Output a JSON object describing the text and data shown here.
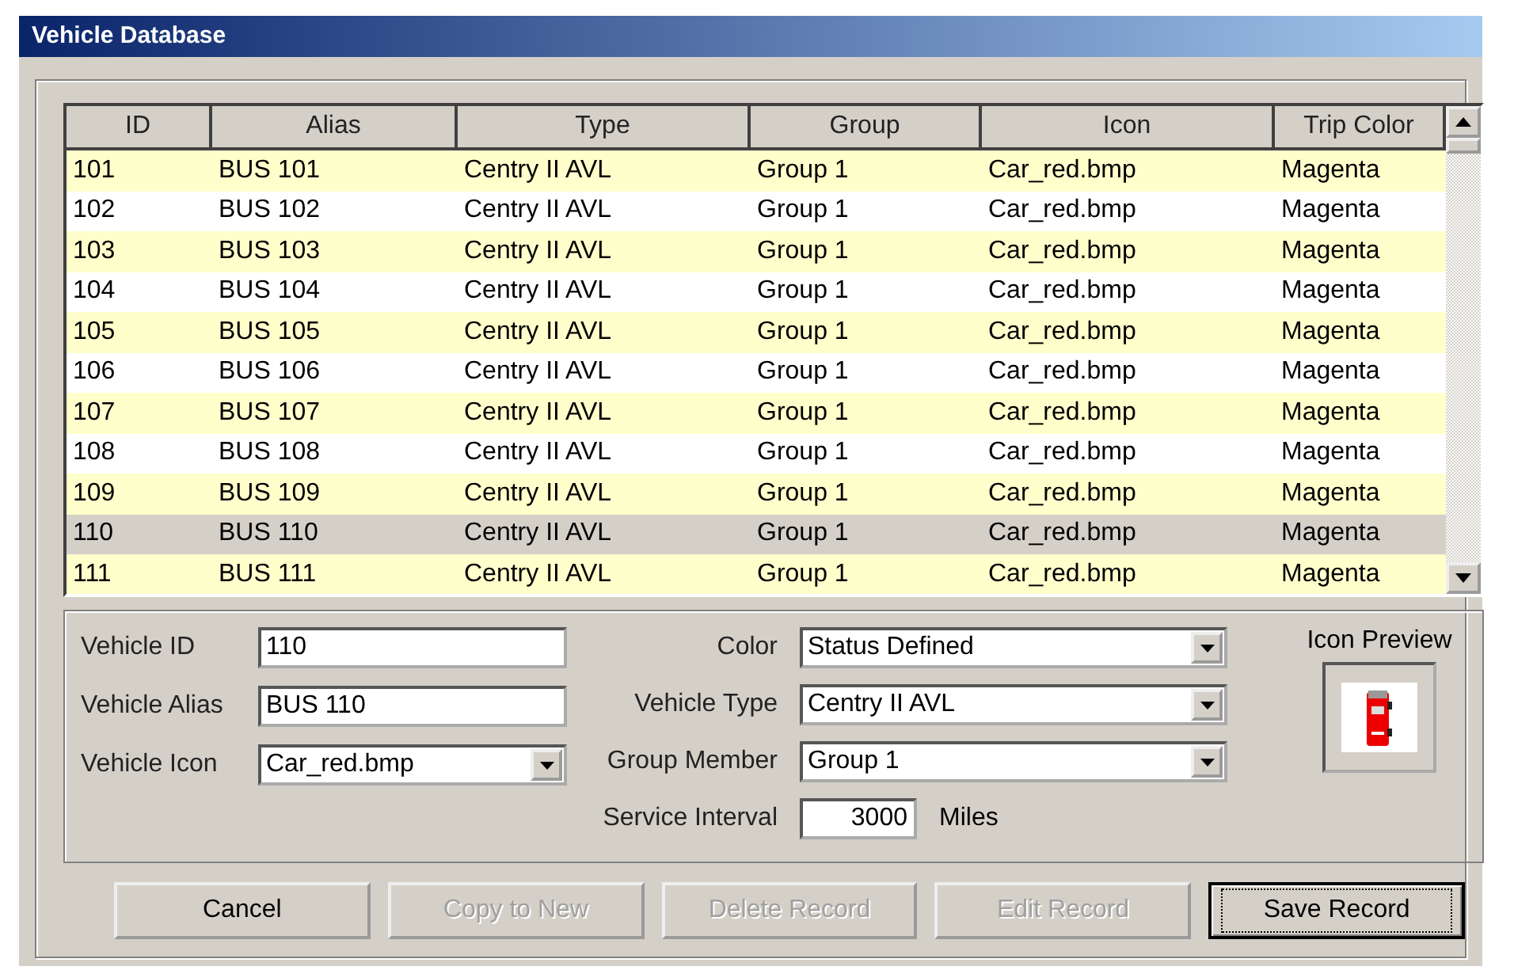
{
  "window": {
    "title": "Vehicle Database"
  },
  "table": {
    "columns": [
      "ID",
      "Alias",
      "Type",
      "Group",
      "Icon",
      "Trip Color"
    ],
    "rows": [
      {
        "cells": [
          "101",
          "BUS 101",
          "Centry II AVL",
          "Group 1",
          "Car_red.bmp",
          "Magenta"
        ],
        "selected": false
      },
      {
        "cells": [
          "102",
          "BUS 102",
          "Centry II AVL",
          "Group 1",
          "Car_red.bmp",
          "Magenta"
        ],
        "selected": false
      },
      {
        "cells": [
          "103",
          "BUS 103",
          "Centry II AVL",
          "Group 1",
          "Car_red.bmp",
          "Magenta"
        ],
        "selected": false
      },
      {
        "cells": [
          "104",
          "BUS 104",
          "Centry II AVL",
          "Group 1",
          "Car_red.bmp",
          "Magenta"
        ],
        "selected": false
      },
      {
        "cells": [
          "105",
          "BUS 105",
          "Centry II AVL",
          "Group 1",
          "Car_red.bmp",
          "Magenta"
        ],
        "selected": false
      },
      {
        "cells": [
          "106",
          "BUS 106",
          "Centry II AVL",
          "Group 1",
          "Car_red.bmp",
          "Magenta"
        ],
        "selected": false
      },
      {
        "cells": [
          "107",
          "BUS 107",
          "Centry II AVL",
          "Group 1",
          "Car_red.bmp",
          "Magenta"
        ],
        "selected": false
      },
      {
        "cells": [
          "108",
          "BUS 108",
          "Centry II AVL",
          "Group 1",
          "Car_red.bmp",
          "Magenta"
        ],
        "selected": false
      },
      {
        "cells": [
          "109",
          "BUS 109",
          "Centry II AVL",
          "Group 1",
          "Car_red.bmp",
          "Magenta"
        ],
        "selected": false
      },
      {
        "cells": [
          "110",
          "BUS 110",
          "Centry II AVL",
          "Group 1",
          "Car_red.bmp",
          "Magenta"
        ],
        "selected": true
      },
      {
        "cells": [
          "111",
          "BUS 111",
          "Centry II AVL",
          "Group 1",
          "Car_red.bmp",
          "Magenta"
        ],
        "selected": false
      }
    ]
  },
  "form": {
    "left": [
      {
        "label": "Vehicle ID",
        "value": "110",
        "kind": "text"
      },
      {
        "label": "Vehicle Alias",
        "value": "BUS 110",
        "kind": "text"
      },
      {
        "label": "Vehicle Icon",
        "value": "Car_red.bmp",
        "kind": "combo"
      }
    ],
    "right": [
      {
        "label": "Color",
        "value": "Status Defined",
        "kind": "combo"
      },
      {
        "label": "Vehicle Type",
        "value": "Centry II AVL",
        "kind": "combo"
      },
      {
        "label": "Group Member",
        "value": "Group 1",
        "kind": "combo"
      }
    ],
    "service_interval": {
      "label": "Service Interval",
      "value": "3000",
      "unit": "Miles"
    },
    "icon_preview": {
      "label": "Icon Preview"
    }
  },
  "buttons": [
    {
      "label": "Cancel",
      "disabled": false,
      "focused": false
    },
    {
      "label": "Copy to New",
      "disabled": true,
      "focused": false
    },
    {
      "label": "Delete Record",
      "disabled": true,
      "focused": false
    },
    {
      "label": "Edit Record",
      "disabled": true,
      "focused": false
    },
    {
      "label": "Save Record",
      "disabled": false,
      "focused": true
    }
  ]
}
